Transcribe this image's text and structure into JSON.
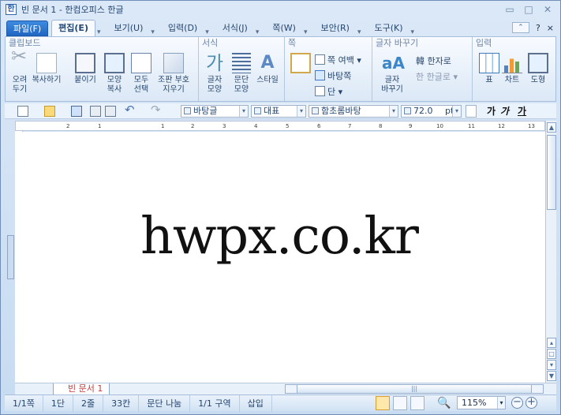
{
  "window": {
    "title": "빈 문서 1 - 한컴오피스 한글",
    "icon": "hwp-app-icon"
  },
  "tabs": [
    {
      "label": "파일(F)"
    },
    {
      "label": "편집(E)"
    },
    {
      "label": "보기(U)"
    },
    {
      "label": "입력(D)"
    },
    {
      "label": "서식(J)"
    },
    {
      "label": "쪽(W)"
    },
    {
      "label": "보안(R)"
    },
    {
      "label": "도구(K)"
    }
  ],
  "ribbon": {
    "clipboard": {
      "title": "클립보드",
      "cut": "오려\n두기",
      "copy": "복사하기",
      "paste": "붙이기",
      "shape_copy": "모양\n복사",
      "select_all": "모두\n선택",
      "clear_format": "조판 부호\n지우기"
    },
    "format": {
      "title": "서식",
      "char_shape": "글자\n모양",
      "para_shape": "문단\n모양",
      "style": "스타일"
    },
    "page": {
      "title": "쪽",
      "page_margin": "쪽 여백",
      "background": "바탕쪽",
      "column": "단"
    },
    "char_change": {
      "title": "글자 바꾸기",
      "hanja": "한자로",
      "hangul": "한글로",
      "change_char": "글자\n바꾸기"
    },
    "insert": {
      "title": "입력",
      "table": "표",
      "chart": "차트",
      "drawing": "도형"
    }
  },
  "toolbar": {
    "style": "바탕글",
    "representative": "대표",
    "font": "함초롬바탕",
    "size": "72.0",
    "unit": "pt",
    "bold": "가",
    "italic": "가",
    "underline": "가"
  },
  "ruler": {
    "ticks": [
      "2",
      "1",
      "1",
      "2",
      "3",
      "4",
      "5",
      "6",
      "7",
      "8",
      "9",
      "10",
      "11",
      "12",
      "13"
    ]
  },
  "document": {
    "text": "hwpx.co.kr",
    "tab": "빈 문서 1"
  },
  "status": {
    "page": "1/1쪽",
    "column": "1단",
    "line": "2줄",
    "char": "33칸",
    "para": "문단 나눔",
    "section": "1/1 구역",
    "mode": "삽입",
    "zoom": "115%"
  },
  "colors": {
    "file_tab": "#1f66c3",
    "document_tab": "#c43b3b",
    "status_accent": "#d89a31"
  }
}
